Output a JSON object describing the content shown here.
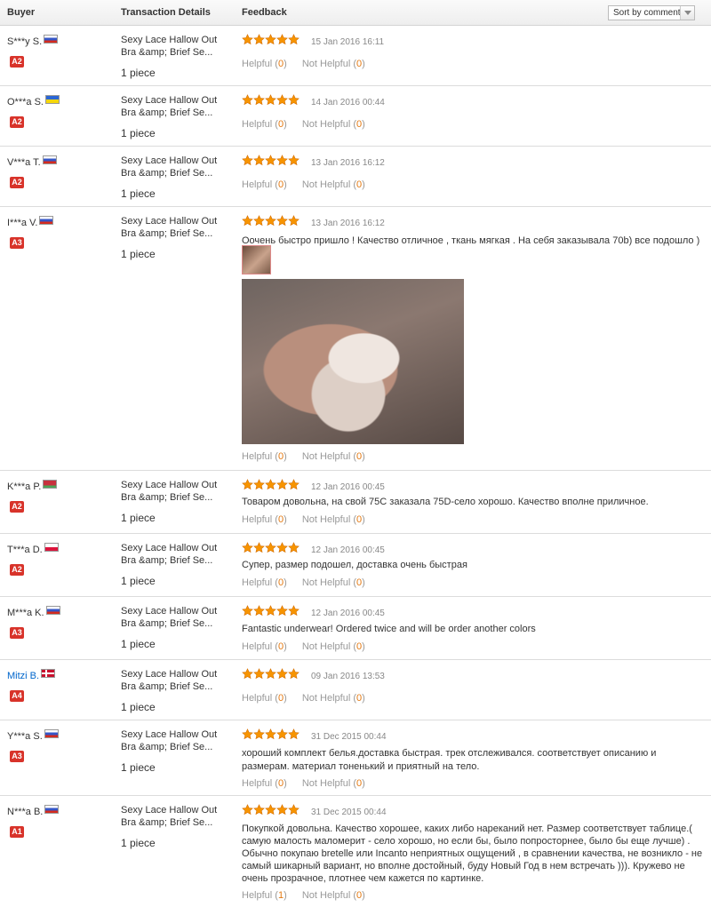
{
  "header": {
    "buyer": "Buyer",
    "transaction": "Transaction Details",
    "feedback": "Feedback",
    "sort": "Sort by comment"
  },
  "colors": {
    "star": "#f79400",
    "badge": "#d8332a",
    "link": "#0066cc",
    "count": "#e47911"
  },
  "reviews": [
    {
      "buyer": "S***y S.",
      "flag": "flag-ru",
      "badge": "A2",
      "product": "Sexy Lace Hallow Out Bra &amp; Brief Se...",
      "qty": "1 piece",
      "rating": 5,
      "date": "15 Jan 2016 16:11",
      "text": "",
      "helpful_label": "Helpful",
      "helpful": "0",
      "not_helpful_label": "Not Helpful",
      "not_helpful": "0"
    },
    {
      "buyer": "O***a S.",
      "flag": "flag-ua",
      "badge": "A2",
      "product": "Sexy Lace Hallow Out Bra &amp; Brief Se...",
      "qty": "1 piece",
      "rating": 5,
      "date": "14 Jan 2016 00:44",
      "text": "",
      "helpful_label": "Helpful",
      "helpful": "0",
      "not_helpful_label": "Not Helpful",
      "not_helpful": "0"
    },
    {
      "buyer": "V***a T.",
      "flag": "flag-ru",
      "badge": "A2",
      "product": "Sexy Lace Hallow Out Bra &amp; Brief Se...",
      "qty": "1 piece",
      "rating": 5,
      "date": "13 Jan 2016 16:12",
      "text": "",
      "helpful_label": "Helpful",
      "helpful": "0",
      "not_helpful_label": "Not Helpful",
      "not_helpful": "0"
    },
    {
      "buyer": "I***a V.",
      "flag": "flag-ru",
      "badge": "A3",
      "product": "Sexy Lace Hallow Out Bra &amp; Brief Se...",
      "qty": "1 piece",
      "rating": 5,
      "date": "13 Jan 2016 16:12",
      "text": "Оочень быстро пришло ! Качество отличное , ткань мягкая . На себя заказывала 70b) все подошло )",
      "helpful_label": "Helpful",
      "helpful": "0",
      "not_helpful_label": "Not Helpful",
      "not_helpful": "0"
    },
    {
      "buyer": "K***a P.",
      "flag": "flag-by",
      "badge": "A2",
      "product": "Sexy Lace Hallow Out Bra &amp; Brief Se...",
      "qty": "1 piece",
      "rating": 5,
      "date": "12 Jan 2016 00:45",
      "text": "Товаром довольна, на свой 75С заказала 75D-село хорошо. Качество вполне приличное.",
      "helpful_label": "Helpful",
      "helpful": "0",
      "not_helpful_label": "Not Helpful",
      "not_helpful": "0"
    },
    {
      "buyer": "T***a D.",
      "flag": "flag-pl",
      "badge": "A2",
      "product": "Sexy Lace Hallow Out Bra &amp; Brief Se...",
      "qty": "1 piece",
      "rating": 5,
      "date": "12 Jan 2016 00:45",
      "text": "Супер, размер подошел, доставка очень быстрая",
      "helpful_label": "Helpful",
      "helpful": "0",
      "not_helpful_label": "Not Helpful",
      "not_helpful": "0"
    },
    {
      "buyer": "M***a K.",
      "flag": "flag-ru",
      "badge": "A3",
      "product": "Sexy Lace Hallow Out Bra &amp; Brief Se...",
      "qty": "1 piece",
      "rating": 5,
      "date": "12 Jan 2016 00:45",
      "text": "Fantastic underwear! Ordered twice and will be order another colors",
      "helpful_label": "Helpful",
      "helpful": "0",
      "not_helpful_label": "Not Helpful",
      "not_helpful": "0"
    },
    {
      "buyer": "Mitzi B.",
      "flag": "flag-dk",
      "badge": "A4",
      "product": "Sexy Lace Hallow Out Bra &amp; Brief Se...",
      "qty": "1 piece",
      "rating": 5,
      "date": "09 Jan 2016 13:53",
      "text": "",
      "helpful_label": "Helpful",
      "helpful": "0",
      "not_helpful_label": "Not Helpful",
      "not_helpful": "0"
    },
    {
      "buyer": "Y***a S.",
      "flag": "flag-ru",
      "badge": "A3",
      "product": "Sexy Lace Hallow Out Bra &amp; Brief Se...",
      "qty": "1 piece",
      "rating": 5,
      "date": "31 Dec 2015 00:44",
      "text": "хороший комплект белья.доставка быстрая. трек отслеживался. соответствует описанию и размерам. материал тоненький и приятный на тело.",
      "helpful_label": "Helpful",
      "helpful": "0",
      "not_helpful_label": "Not Helpful",
      "not_helpful": "0"
    },
    {
      "buyer": "N***a B.",
      "flag": "flag-ru",
      "badge": "A1",
      "product": "Sexy Lace Hallow Out Bra &amp; Brief Se...",
      "qty": "1 piece",
      "rating": 5,
      "date": "31 Dec 2015 00:44",
      "text": "Покупкой довольна. Качество хорошее, каких либо нареканий нет. Размер соответствует таблице.( самую малость маломерит - село хорошо, но если бы, было попросторнее, было бы еще лучше) . Обычно покупаю bretelle или Incanto неприятных ощущений , в сравнении качества, не возникло - не самый шикарный вариант, но вполне достойный, буду Новый Год в нем встречать ))). Кружево не очень прозрачное, плотнее чем кажется по картинке.",
      "helpful_label": "Helpful",
      "helpful": "1",
      "not_helpful_label": "Not Helpful",
      "not_helpful": "0"
    }
  ]
}
